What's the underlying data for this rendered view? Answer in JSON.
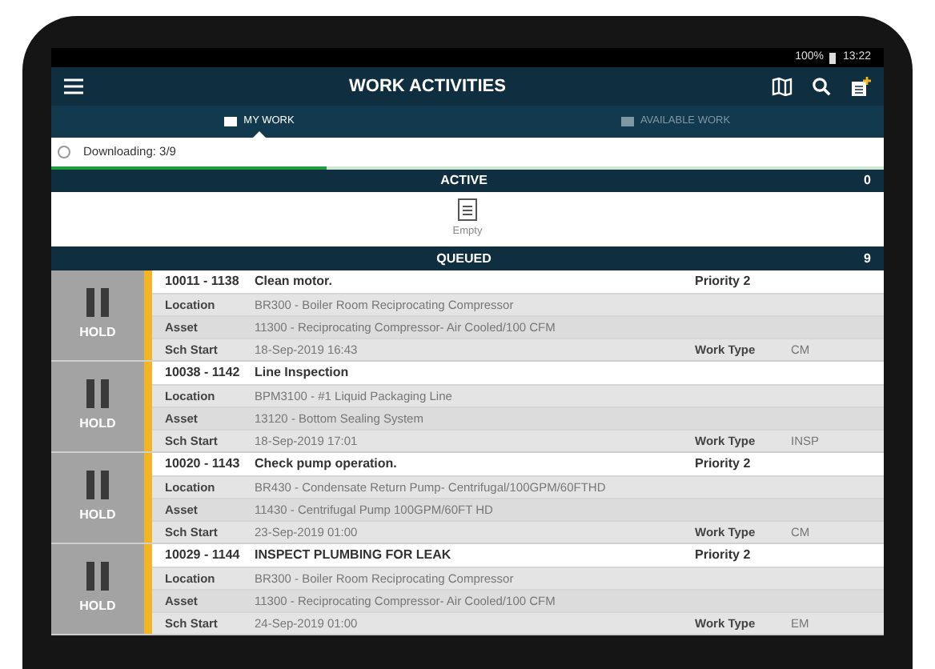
{
  "status_bar": {
    "battery": "100%",
    "time": "13:22"
  },
  "header": {
    "title": "WORK ACTIVITIES"
  },
  "tabs": [
    {
      "label": "MY WORK",
      "selected": true
    },
    {
      "label": "AVAILABLE WORK",
      "selected": false
    }
  ],
  "download": {
    "text": "Downloading: 3/9",
    "level": 0.33
  },
  "active": {
    "title": "ACTIVE",
    "count": "0",
    "empty_text": "Empty"
  },
  "queued": {
    "title": "QUEUED",
    "count": "9",
    "items": [
      {
        "status": "HOLD",
        "id": "10011 - 1138",
        "description": "Clean motor.",
        "priority": "Priority 2",
        "fields": [
          {
            "label": "Location",
            "value": "BR300 - Boiler Room Reciprocating Compressor"
          },
          {
            "label": "Asset",
            "value": "11300 - Reciprocating Compressor- Air Cooled/100 CFM"
          },
          {
            "label": "Sch Start",
            "value": "18-Sep-2019 16:43",
            "extra_label": "Work Type",
            "extra_value": "CM"
          }
        ]
      },
      {
        "status": "HOLD",
        "id": "10038 - 1142",
        "description": "Line Inspection",
        "fields": [
          {
            "label": "Location",
            "value": "BPM3100 - #1 Liquid Packaging Line"
          },
          {
            "label": "Asset",
            "value": "13120 - Bottom Sealing System"
          },
          {
            "label": "Sch Start",
            "value": "18-Sep-2019 17:01",
            "extra_label": "Work Type",
            "extra_value": "INSP"
          }
        ]
      },
      {
        "status": "HOLD",
        "id": "10020 - 1143",
        "description": "Check pump operation.",
        "priority": "Priority 2",
        "fields": [
          {
            "label": "Location",
            "value": "BR430 - Condensate Return Pump- Centrifugal/100GPM/60FTHD"
          },
          {
            "label": "Asset",
            "value": "11430 - Centrifugal Pump 100GPM/60FT HD"
          },
          {
            "label": "Sch Start",
            "value": "23-Sep-2019 01:00",
            "extra_label": "Work Type",
            "extra_value": "CM"
          }
        ]
      },
      {
        "status": "HOLD",
        "id": "10029 - 1144",
        "description": "INSPECT PLUMBING FOR LEAK",
        "priority": "Priority 2",
        "fields": [
          {
            "label": "Location",
            "value": "BR300 - Boiler Room Reciprocating Compressor"
          },
          {
            "label": "Asset",
            "value": "11300 - Reciprocating Compressor- Air Cooled/100 CFM"
          },
          {
            "label": "Sch Start",
            "value": "24-Sep-2019 01:00",
            "extra_label": "Work Type",
            "extra_value": "EM"
          }
        ]
      }
    ]
  }
}
